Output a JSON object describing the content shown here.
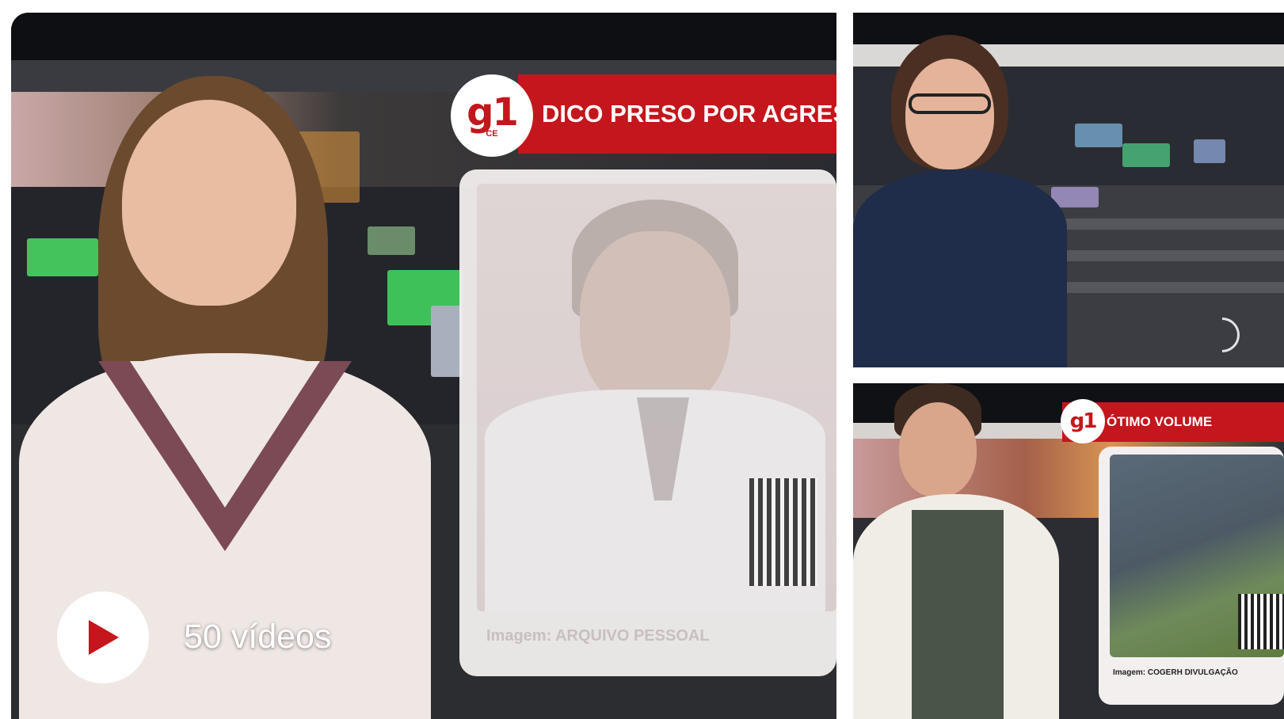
{
  "main_tile": {
    "headline": "DICO PRESO POR AGRES",
    "logo_mark": "g1",
    "logo_region": "CE",
    "photo_credit": "Imagem: ARQUIVO PESSOAL",
    "video_count_label": "50 vídeos",
    "play_icon": "play-triangle-icon"
  },
  "side_top_tile": {
    "spinner_icon": "loading-spinner-icon"
  },
  "side_bottom_tile": {
    "logo_mark": "g1",
    "headline": "ÓTIMO VOLUME",
    "photo_credit": "Imagem: COGERH DIVULGAÇÃO"
  },
  "colors": {
    "brand_red": "#c4161c",
    "white": "#ffffff",
    "backdrop_dark": "#1b1c20"
  }
}
